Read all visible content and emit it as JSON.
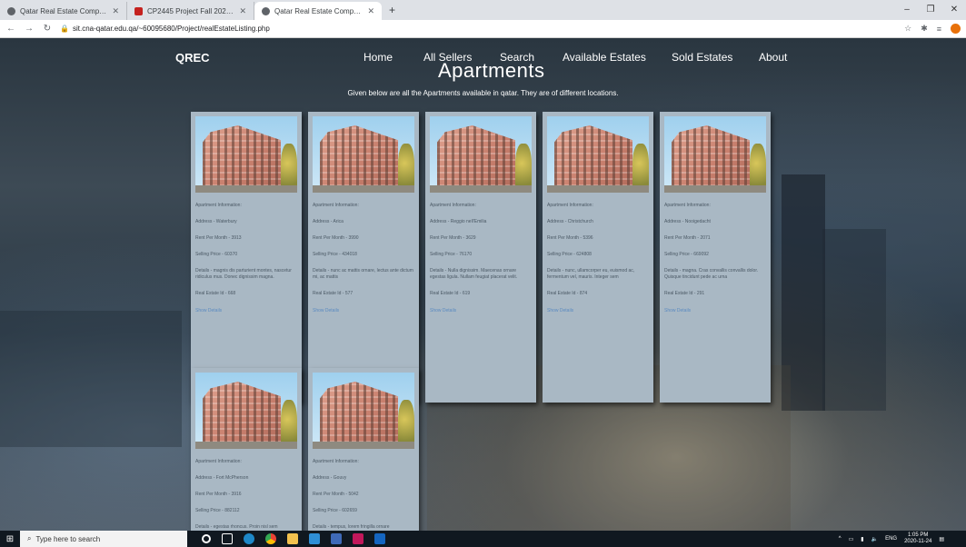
{
  "browser": {
    "tabs": [
      {
        "title": "Qatar Real Estate Company",
        "active": false
      },
      {
        "title": "CP2445 Project Fall 2020 - CP24",
        "active": false
      },
      {
        "title": "Qatar Real Estate Company",
        "active": true
      }
    ],
    "new_tab": "+",
    "url": "sit.cna-qatar.edu.qa/~60095680/Project/realEstateListing.php"
  },
  "nav": {
    "brand": "QREC",
    "items": [
      "Home",
      "All Sellers",
      "Search",
      "Available Estates",
      "Sold Estates",
      "About"
    ]
  },
  "page": {
    "title": "Apartments",
    "subtitle": "Given below are all the Apartments available in qatar. They are of different locations."
  },
  "cards": [
    {
      "heading": "Apartment Information:",
      "address": "Address - Waterbury",
      "rent": "Rent Per Month - 3913",
      "selling": "Selling Price - 60370",
      "details": "Details - magnis dis parturient montes, nascetur ridiculus mus. Donec dignissim magna.",
      "id": "Real Estate Id - 668",
      "link": "Show Details"
    },
    {
      "heading": "Apartment Information:",
      "address": "Address - Arica",
      "rent": "Rent Per Month - 3990",
      "selling": "Selling Price - 434018",
      "details": "Details - nunc ac mattis ornare, lectus ante dictum mi, ac mattis",
      "id": "Real Estate Id - 577",
      "link": "Show Details"
    },
    {
      "heading": "Apartment Information:",
      "address": "Address - Reggio nell'Emilia",
      "rent": "Rent Per Month - 3629",
      "selling": "Selling Price - 76170",
      "details": "Details - Nulla dignissim. Maecenas ornare egestas ligula. Nullam feugiat placerat velit.",
      "id": "Real Estate Id - 619",
      "link": "Show Details"
    },
    {
      "heading": "Apartment Information:",
      "address": "Address - Christchurch",
      "rent": "Rent Per Month - 5396",
      "selling": "Selling Price - 624808",
      "details": "Details - nunc, ullamcorper eu, euismod ac, fermentum vel, mauris. Integer sem",
      "id": "Real Estate Id - 874",
      "link": "Show Details"
    },
    {
      "heading": "Apartment Information:",
      "address": "Address - Nooigedacht",
      "rent": "Rent Per Month - 2071",
      "selling": "Selling Price - 669092",
      "details": "Details - magna. Cras convallis convallis dolor. Quisque tincidunt pede ac urna",
      "id": "Real Estate Id - 291",
      "link": "Show Details"
    },
    {
      "heading": "Apartment Information:",
      "address": "Address - Fort McPherson",
      "rent": "Rent Per Month - 3916",
      "selling": "Selling Price - 882112",
      "details": "Details - egestas rhoncus. Proin nisl sem",
      "id": "",
      "link": ""
    },
    {
      "heading": "Apartment Information:",
      "address": "Address - Gouvy",
      "rent": "Rent Per Month - 5042",
      "selling": "Selling Price - 602659",
      "details": "Details - tempus, lorem fringilla ornare",
      "id": "",
      "link": ""
    }
  ],
  "taskbar": {
    "search_placeholder": "Type here to search",
    "lang": "ENG",
    "time": "1:05 PM",
    "date": "2020-11-24"
  },
  "colors": {
    "card_bg": "#a9b8c4",
    "link": "#5a8ac0",
    "taskbar": "#101820"
  }
}
